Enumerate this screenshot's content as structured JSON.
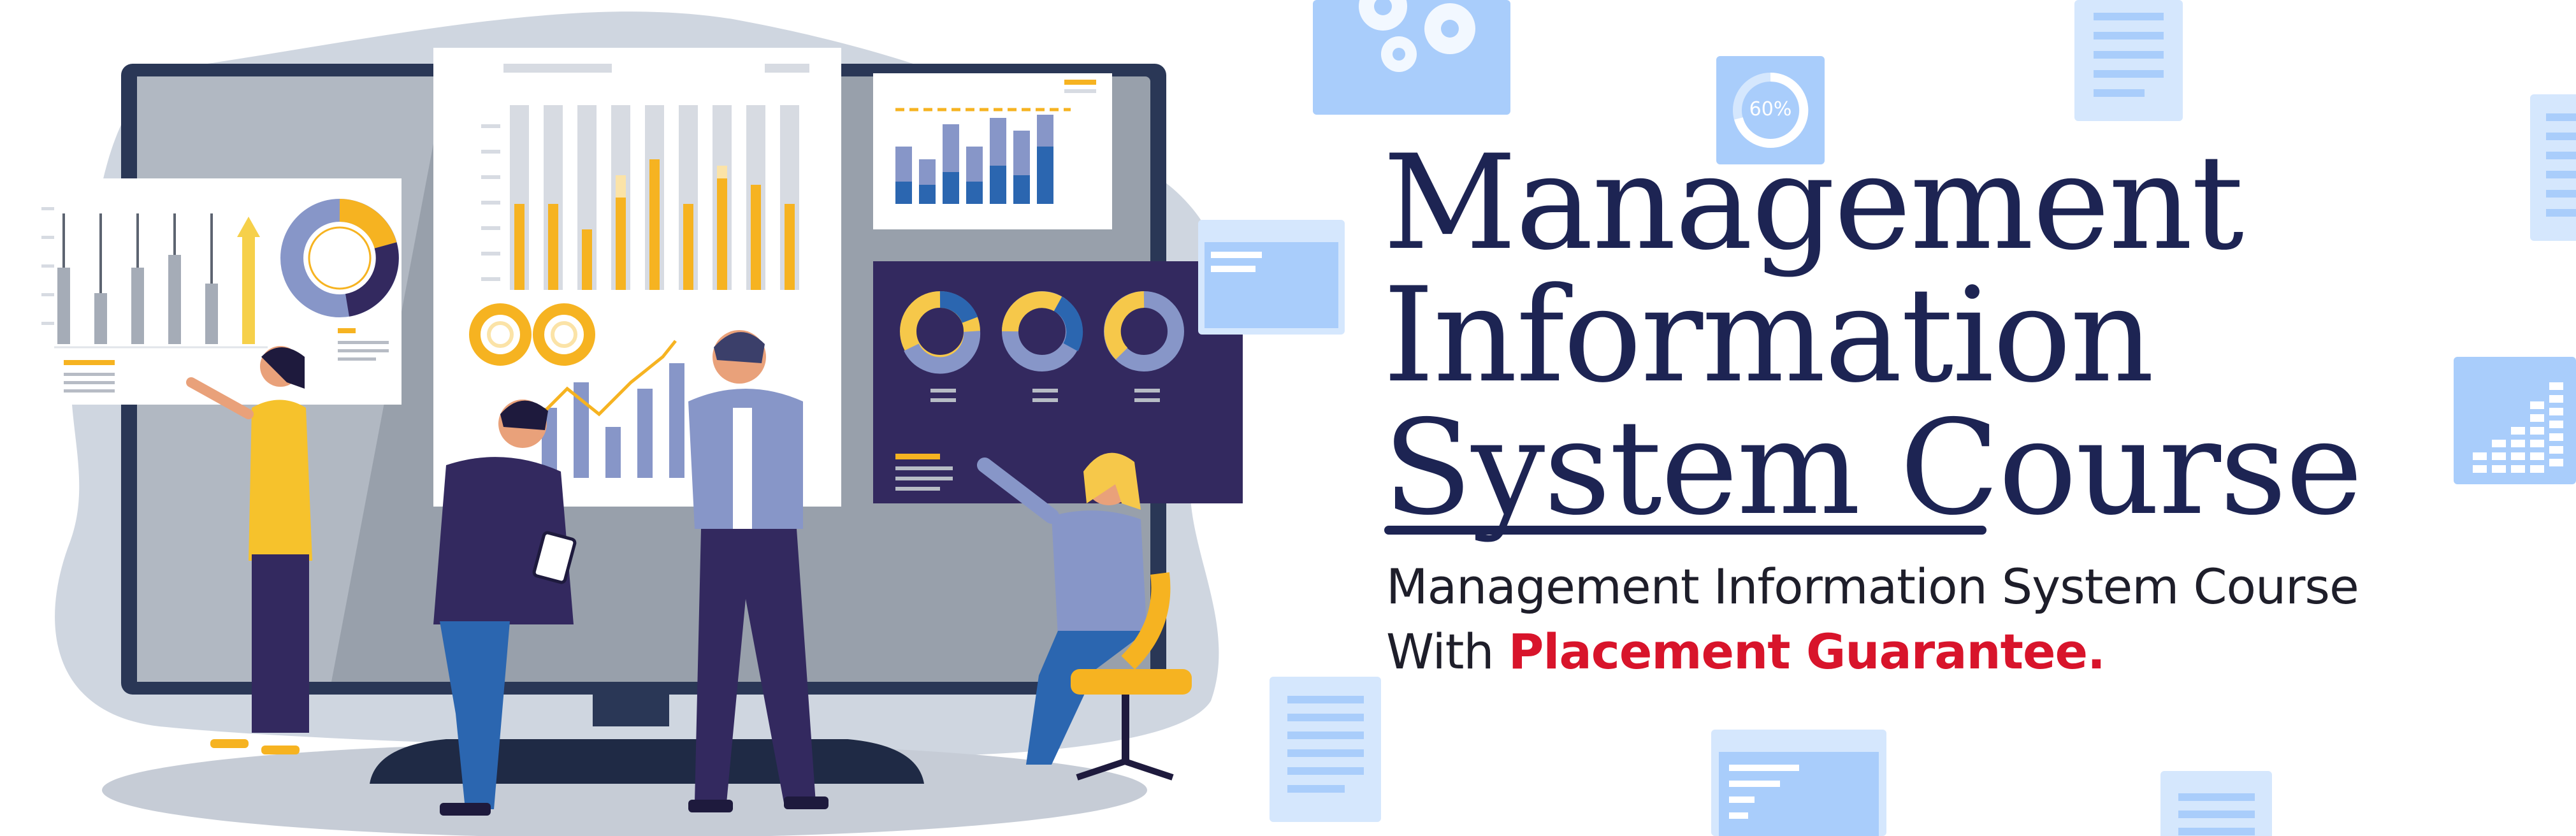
{
  "heading": {
    "lines": [
      "Management",
      "Information",
      "System Course"
    ]
  },
  "subtitle": {
    "line1": "Management Information System Course",
    "line2_prefix": "With",
    "highlight": "Placement Guarantee."
  },
  "decorations": {
    "donut_label": "60%",
    "icons": [
      "gear-icon",
      "document-icon",
      "donut-chart-icon",
      "bar-chart-icon",
      "browser-window-icon"
    ]
  },
  "colors": {
    "heading": "#1d2453",
    "highlight": "#d8142b",
    "accent_yellow": "#f6b321",
    "accent_navy": "#33295f",
    "deco_blue": "#a9cdfb"
  }
}
